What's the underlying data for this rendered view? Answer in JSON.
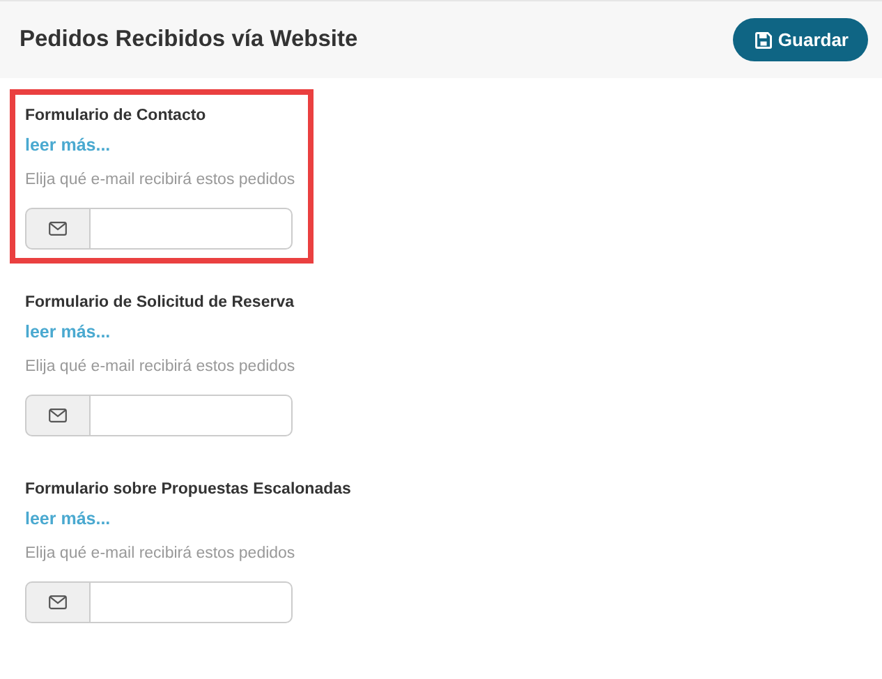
{
  "header": {
    "title": "Pedidos Recibidos vía Website",
    "save_button": "Guardar"
  },
  "forms": [
    {
      "title": "Formulario de Contacto",
      "link": "leer más...",
      "hint": "Elija qué e-mail recibirá estos pedidos",
      "highlighted": true
    },
    {
      "title": "Formulario de Solicitud de Reserva",
      "link": "leer más...",
      "hint": "Elija qué e-mail recibirá estos pedidos",
      "highlighted": false
    },
    {
      "title": "Formulario sobre Propuestas Escalonadas",
      "link": "leer más...",
      "hint": "Elija qué e-mail recibirá estos pedidos",
      "highlighted": false
    }
  ]
}
